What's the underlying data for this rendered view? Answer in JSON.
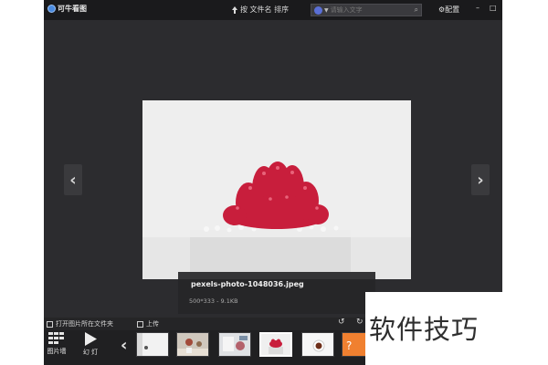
{
  "app": {
    "title": "可牛看图"
  },
  "header": {
    "sort_label": "按 文件名 排序",
    "search_placeholder": "请输入文字",
    "config_label": "配置"
  },
  "image": {
    "filename": "pexels-photo-1048036.jpeg",
    "meta": "500*333 - 9.1KB"
  },
  "actions": {
    "open_folder": "打开图片所在文件夹",
    "upload": "上传"
  },
  "toolbar": {
    "wall_label": "图片墙",
    "slideshow_label": "幻 灯"
  },
  "watermark": "软件技巧",
  "colors": {
    "background": "#2c2c2f",
    "titlebar": "#1a1a1c",
    "accent": "#f08030"
  }
}
